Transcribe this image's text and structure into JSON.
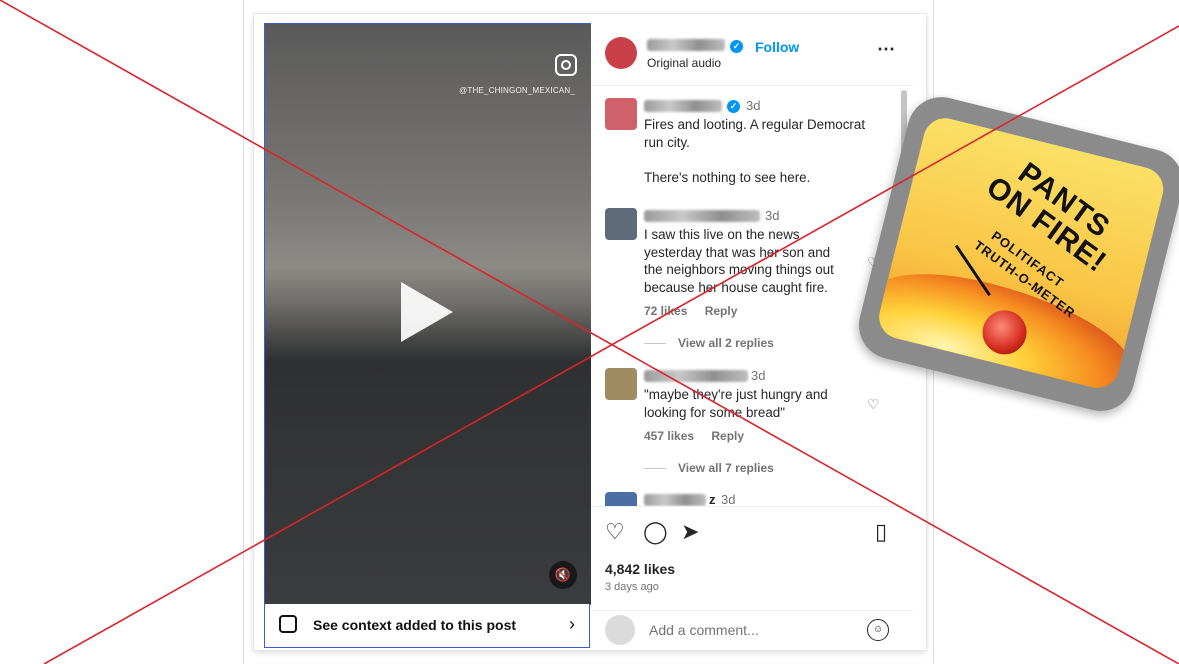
{
  "video": {
    "watermark": "@THE_CHINGON_MEXICAN_",
    "context_label": "See context added to this post"
  },
  "header": {
    "follow_label": "Follow",
    "subtitle": "Original audio"
  },
  "comments": [
    {
      "time": "3d",
      "text": "Fires and looting. A regular Democrat\nrun city.\n\nThere's nothing to see here."
    },
    {
      "time": "3d",
      "text": "I saw this live on the news\nyesterday that was her son and\nthe neighbors moving things out\nbecause her house caught fire.",
      "likes": "72 likes",
      "reply": "Reply",
      "view_replies": "View all 2 replies"
    },
    {
      "time": "3d",
      "text": "\"maybe they're just hungry and\nlooking for some bread\"",
      "likes": "457 likes",
      "reply": "Reply",
      "view_replies": "View all 7 replies"
    },
    {
      "name_suffix": "z",
      "time": "3d"
    }
  ],
  "post": {
    "likes": "4,842 likes",
    "time_ago": "3 days ago",
    "comment_placeholder": "Add a comment..."
  },
  "badge": {
    "title": "PANTS ON FIRE!",
    "brand": "POLITIFACT",
    "meter": "TRUTH-O-METER"
  },
  "icons": {
    "like": "heart-icon",
    "comment": "comment-icon",
    "share": "paper-plane-icon",
    "save": "bookmark-icon"
  },
  "colors": {
    "link": "#0095f6",
    "strike": "#d9242b",
    "verified": "#0095f6"
  }
}
